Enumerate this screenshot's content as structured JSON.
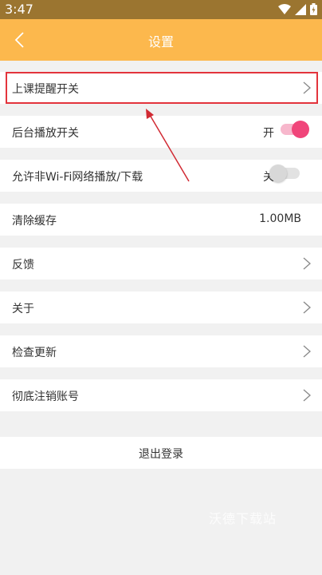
{
  "status_bar": {
    "time": "3:47"
  },
  "app_bar": {
    "title": "设置",
    "back_icon": "back-arrow-icon"
  },
  "settings": {
    "class_reminder": {
      "label": "上课提醒开关"
    },
    "background_play": {
      "label": "后台播放开关",
      "state_text": "开",
      "enabled": true
    },
    "non_wifi": {
      "label": "允许非Wi-Fi网络播放/下载",
      "state_text": "关",
      "enabled": false
    },
    "clear_cache": {
      "label": "清除缓存",
      "value": "1.00MB"
    },
    "feedback": {
      "label": "反馈"
    },
    "about": {
      "label": "关于"
    },
    "check_update": {
      "label": "检查更新"
    },
    "cancel_account": {
      "label": "彻底注销账号"
    }
  },
  "logout": {
    "label": "退出登录"
  },
  "watermark": "沃德下载站",
  "colors": {
    "accent": "#fcb84d",
    "toggle_on": "#f0457a",
    "annotation": "#e3343c"
  }
}
